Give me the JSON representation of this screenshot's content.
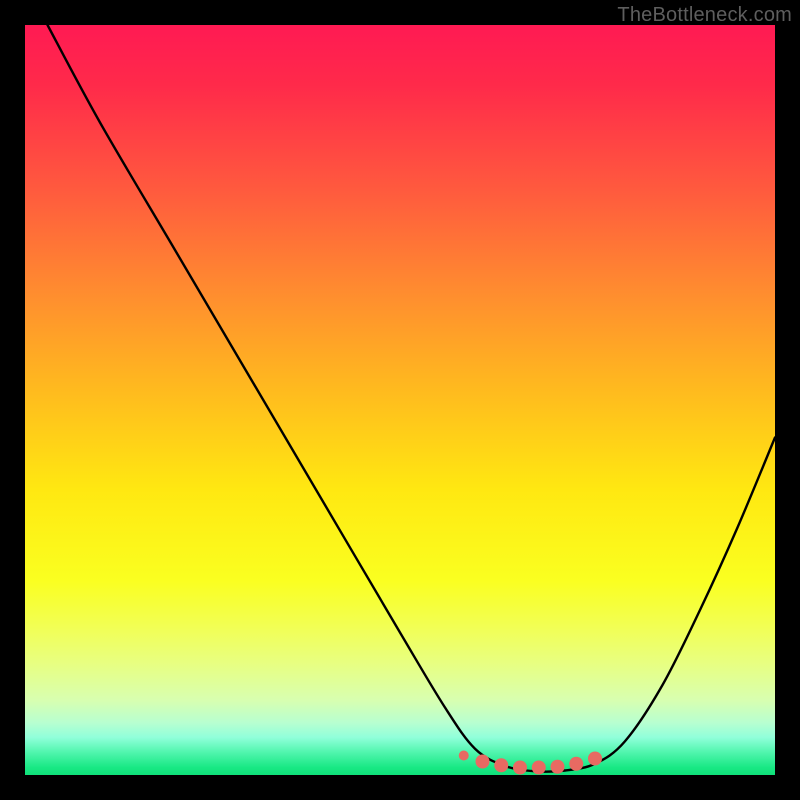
{
  "watermark": "TheBottleneck.com",
  "colors": {
    "frame": "#000000",
    "curve": "#000000",
    "marker_fill": "#e86a62",
    "marker_stroke": "#d85a54"
  },
  "chart_data": {
    "type": "line",
    "title": "",
    "xlabel": "",
    "ylabel": "",
    "xlim": [
      0,
      100
    ],
    "ylim": [
      0,
      100
    ],
    "grid": false,
    "legend": false,
    "series": [
      {
        "name": "bottleneck-curve",
        "x": [
          3,
          10,
          20,
          30,
          40,
          50,
          56,
          60,
          64,
          68,
          72,
          76,
          80,
          85,
          90,
          95,
          100
        ],
        "values": [
          100,
          87,
          70,
          53,
          36,
          19,
          9,
          3.5,
          1.2,
          0.5,
          0.6,
          1.5,
          4.5,
          12,
          22,
          33,
          45
        ]
      }
    ],
    "markers": {
      "name": "optimal-range",
      "x": [
        58.5,
        61,
        63.5,
        66,
        68.5,
        71,
        73.5,
        76
      ],
      "values": [
        2.6,
        1.8,
        1.3,
        1.0,
        1.0,
        1.1,
        1.5,
        2.2
      ],
      "radius_first": 5,
      "radius_rest": 7
    },
    "gradient_stops": [
      {
        "pos": 0,
        "color": "#ff1a53"
      },
      {
        "pos": 50,
        "color": "#ffd400"
      },
      {
        "pos": 82,
        "color": "#f5ff4a"
      },
      {
        "pos": 100,
        "color": "#10e07a"
      }
    ]
  }
}
